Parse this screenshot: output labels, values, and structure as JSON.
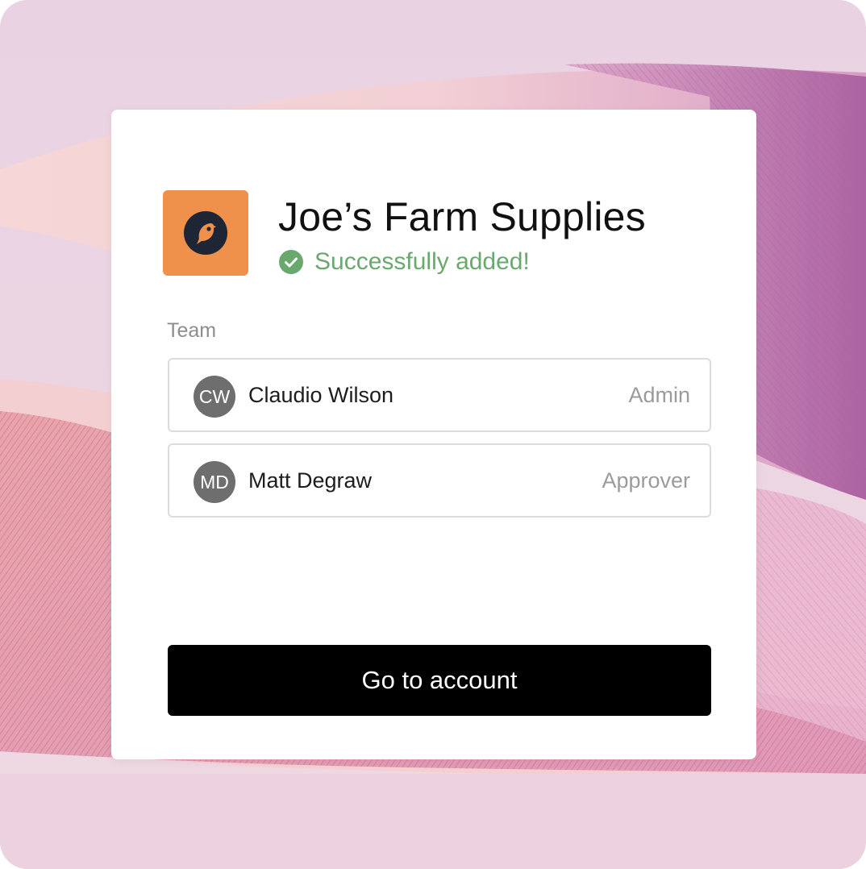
{
  "company": {
    "name": "Joe’s Farm Supplies",
    "logo_icon": "bird-icon",
    "logo_color": "#ef914a"
  },
  "status": {
    "icon": "check-circle-icon",
    "text": "Successfully added!",
    "color": "#6aa96e"
  },
  "team": {
    "label": "Team",
    "members": [
      {
        "initials": "CW",
        "name": "Claudio Wilson",
        "role": "Admin"
      },
      {
        "initials": "MD",
        "name": "Matt Degraw",
        "role": "Approver"
      }
    ]
  },
  "actions": {
    "primary_label": "Go to account"
  },
  "colors": {
    "background": "#e9d3e3",
    "button": "#000000",
    "avatar": "#6e6e6e"
  }
}
